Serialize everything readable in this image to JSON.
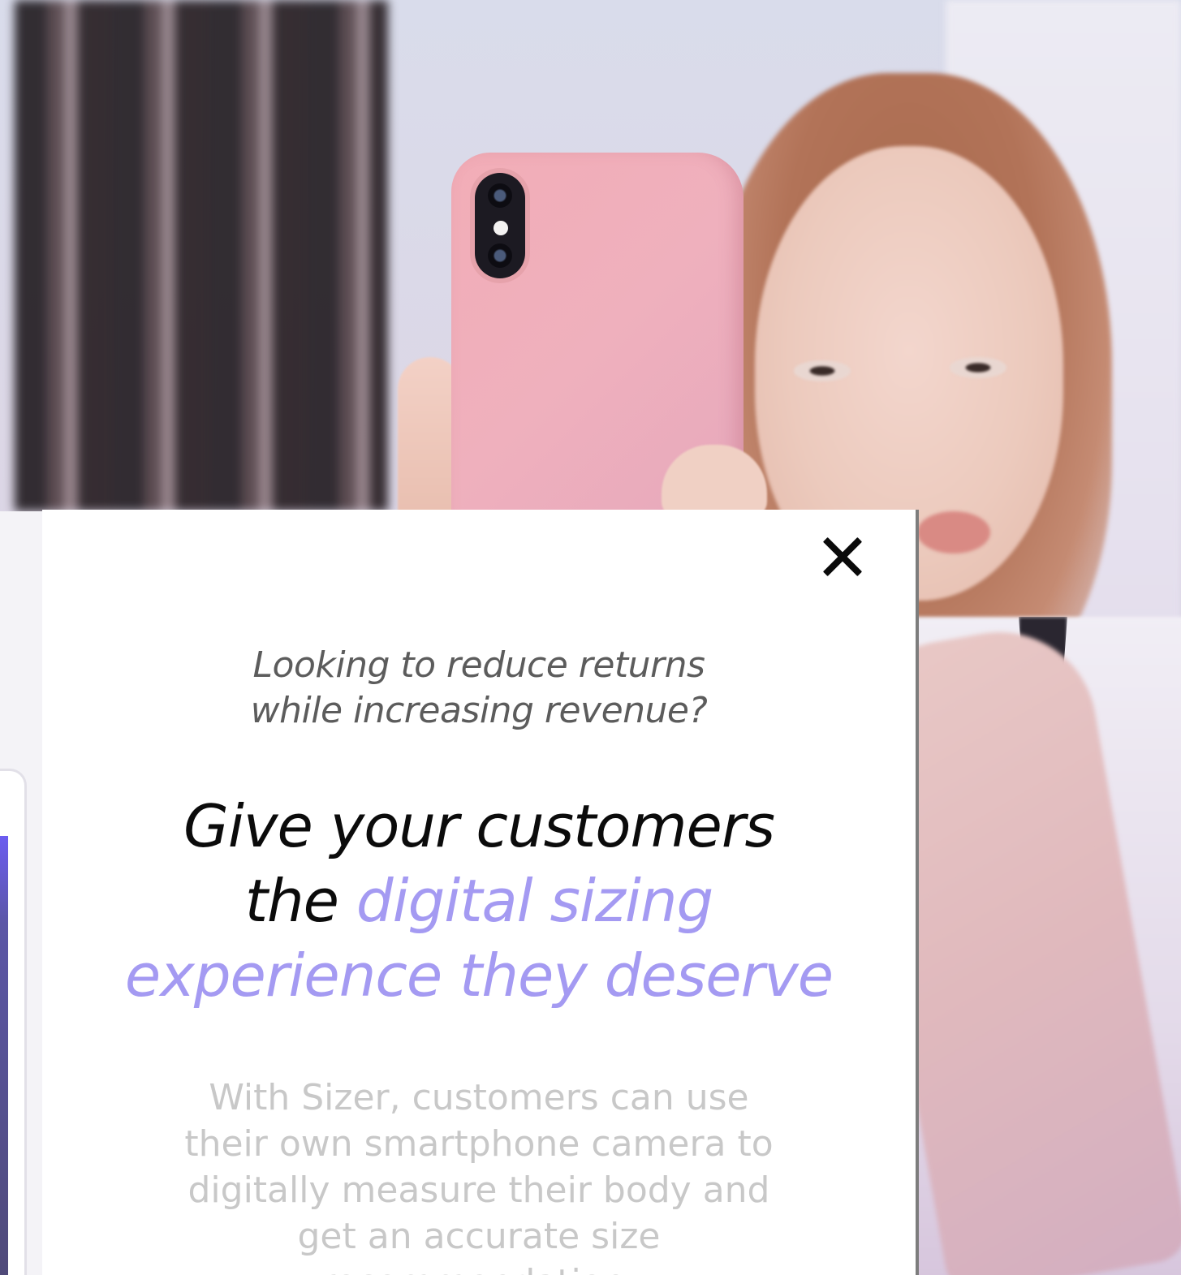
{
  "modal": {
    "eyebrow_line1": "Looking to reduce returns",
    "eyebrow_line2": "while increasing revenue?",
    "headline_part1": "Give your customers",
    "headline_part2": "the",
    "headline_accent1": "digital sizing",
    "headline_accent2": "experience they deserve",
    "body_line1": "With Sizer, customers can use",
    "body_line2": "their own smartphone camera to",
    "body_line3": "digitally measure their body and",
    "body_line4": "get an accurate size",
    "body_line5": "recommendation.",
    "close_icon": "close-icon"
  },
  "colors": {
    "accent": "#a49af2",
    "headline": "#0b0b0b",
    "eyebrow": "#5c5c5c",
    "body": "#c8c8c8"
  }
}
